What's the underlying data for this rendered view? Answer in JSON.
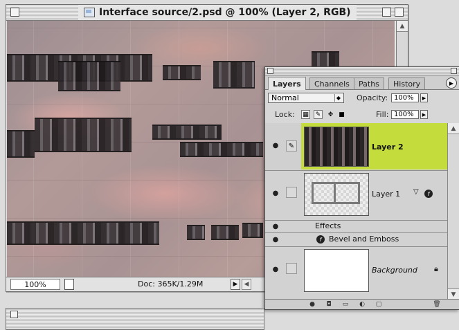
{
  "document_window": {
    "title": "Interface source/2.psd @ 100% (Layer 2, RGB)",
    "status": {
      "zoom": "100%",
      "doc_size": "Doc: 365K/1.29M"
    }
  },
  "layers_palette": {
    "tabs": [
      {
        "label": "Layers",
        "active": true
      },
      {
        "label": "Channels",
        "active": false
      },
      {
        "label": "Paths",
        "active": false
      },
      {
        "label": "History",
        "active": false
      }
    ],
    "blend_mode": "Normal",
    "opacity_label": "Opacity:",
    "opacity_value": "100%",
    "lock_label": "Lock:",
    "fill_label": "Fill:",
    "fill_value": "100%",
    "layers": [
      {
        "name": "Layer 2",
        "selected": true
      },
      {
        "name": "Layer 1",
        "selected": false
      },
      {
        "name": "Background",
        "selected": false
      }
    ],
    "effects_label": "Effects",
    "effect_item": "Bevel and Emboss"
  },
  "colors": {
    "selected_layer": "#c4dc3c",
    "canvas_pink": "#b59a98"
  },
  "icons": [
    "eye-icon",
    "brush-link-icon",
    "lock-icon",
    "move-icon",
    "fx-icon",
    "palette-menu-icon",
    "trash-icon"
  ]
}
